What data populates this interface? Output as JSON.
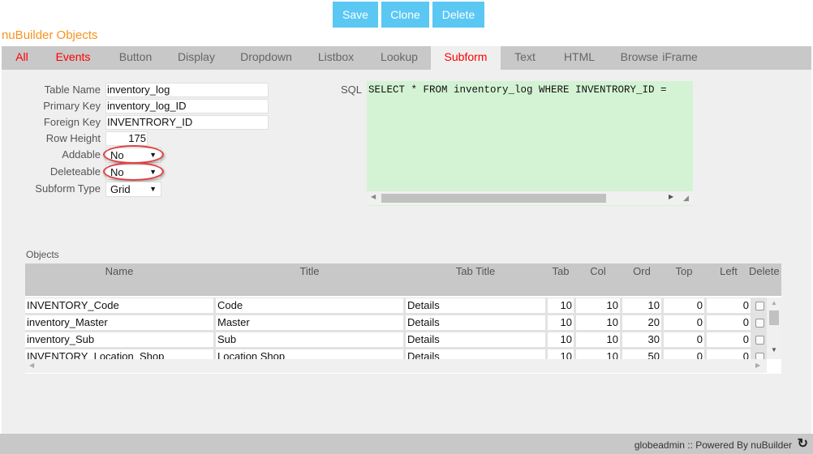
{
  "toolbar": {
    "save": "Save",
    "clone": "Clone",
    "delete": "Delete"
  },
  "title": "nuBuilder Objects",
  "tabs": [
    {
      "label": "All"
    },
    {
      "label": "Events"
    },
    {
      "label": "Button"
    },
    {
      "label": "Display"
    },
    {
      "label": "Dropdown"
    },
    {
      "label": "Listbox"
    },
    {
      "label": "Lookup"
    },
    {
      "label": "Subform"
    },
    {
      "label": "Text"
    },
    {
      "label": "HTML"
    },
    {
      "label": "Browse"
    },
    {
      "label": "iFrame"
    }
  ],
  "active_tab": "Subform",
  "form": {
    "table_name": {
      "label": "Table Name",
      "value": "inventory_log"
    },
    "primary_key": {
      "label": "Primary Key",
      "value": "inventory_log_ID"
    },
    "foreign_key": {
      "label": "Foreign Key",
      "value": "INVENTRORY_ID"
    },
    "row_height": {
      "label": "Row Height",
      "value": "175"
    },
    "addable": {
      "label": "Addable",
      "value": "No"
    },
    "deleteable": {
      "label": "Deleteable",
      "value": "No"
    },
    "subform_type": {
      "label": "Subform Type",
      "value": "Grid"
    },
    "sql": {
      "label": "SQL",
      "value": "SELECT * FROM inventory_log WHERE INVENTRORY_ID ="
    }
  },
  "objects": {
    "label": "Objects",
    "columns": [
      "Name",
      "Title",
      "Tab Title",
      "Tab",
      "Col",
      "Ord",
      "Top",
      "Left",
      "Delete"
    ],
    "rows": [
      [
        "INVENTORY_Code",
        "Code",
        "Details",
        "10",
        "10",
        "10",
        "0",
        "0"
      ],
      [
        "inventory_Master",
        "Master",
        "Details",
        "10",
        "10",
        "20",
        "0",
        "0"
      ],
      [
        "inventory_Sub",
        "Sub",
        "Details",
        "10",
        "10",
        "30",
        "0",
        "0"
      ],
      [
        "INVENTORY_Location_Shop",
        "Location Shop",
        "Details",
        "10",
        "10",
        "50",
        "0",
        "0"
      ]
    ]
  },
  "footer": {
    "text": "globeadmin :: Powered By nuBuilder",
    "icon": "refresh-icon"
  },
  "colors": {
    "accent": "#5bc7f3",
    "title": "#f7931e",
    "active_tab": "#ff0000",
    "sql_bg": "#d4f3d4"
  }
}
